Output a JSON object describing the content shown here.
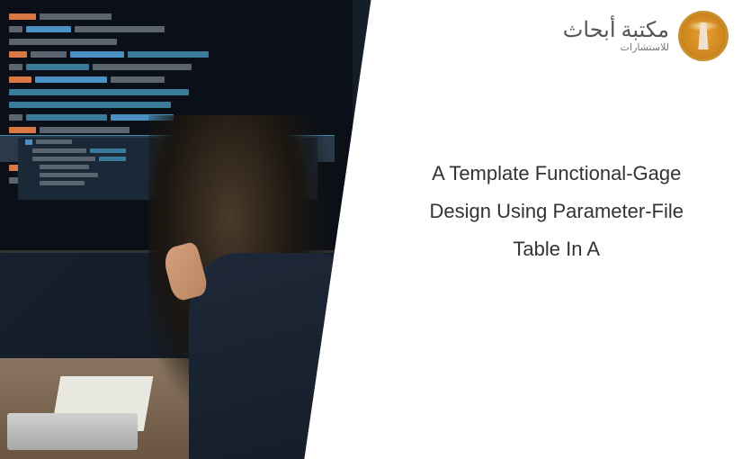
{
  "logo": {
    "primary_text_ar": "مكتبة أبحاث",
    "secondary_text_ar": "للاستشارات",
    "badge_icon": "lighthouse-icon"
  },
  "title": "A Template Functional-Gage Design Using Parameter-File Table In A"
}
